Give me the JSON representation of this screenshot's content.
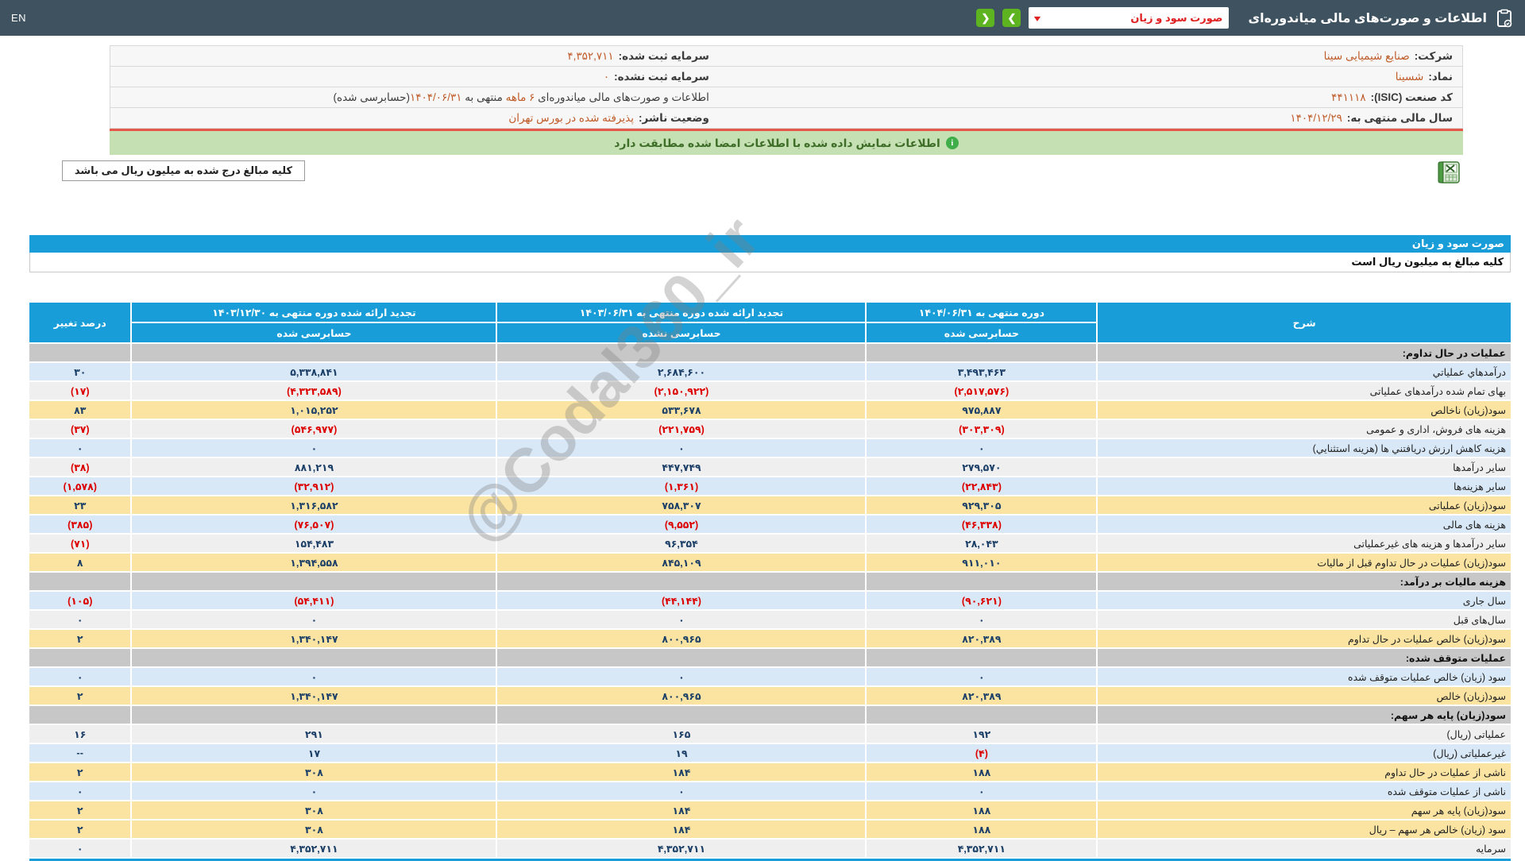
{
  "colors": {
    "accent_blue": "#189dd8",
    "topbar": "#3e5260",
    "negative": "#dd0000",
    "positive_number": "#1d4068",
    "highlight_row": "#fbe3a1",
    "banner_green": "#c5e0b3",
    "red_separator": "#e4574b",
    "nav_button_green": "#5eb321",
    "value_orange": "#bf5b28"
  },
  "topbar": {
    "title": "اطلاعات و صورت‌های مالی میاندوره‌ای",
    "report_select": {
      "value": "صورت سود و زیان",
      "chevron": "▾"
    },
    "nav_prev": "❮",
    "nav_next": "❯",
    "lang": "EN"
  },
  "company": {
    "rows": [
      {
        "rl": "شرکت:",
        "rv": "صنایع شیمیایی سینا",
        "ll": "سرمایه ثبت شده:",
        "lv": "۴,۳۵۲,۷۱۱"
      },
      {
        "rl": "نماد:",
        "rv": "شسینا",
        "ll": "سرمایه ثبت نشده:",
        "lv": "۰"
      },
      {
        "rl": "کد صنعت (ISIC):",
        "rv": "۴۴۱۱۱۸"
      },
      {
        "rl": "سال مالی منتهی به:",
        "rv": "۱۴۰۴/۱۲/۲۹",
        "ll": "وضعیت ناشر:",
        "lv": "پذیرفته شده در بورس تهران"
      }
    ],
    "info_sentence": {
      "p1": "اطلاعات و صورت‌های مالی میاندوره‌ای ",
      "p2": "۶ ماهه",
      "p3": " منتهی به ",
      "p4": "۱۴۰۴/۰۶/۳۱",
      "p5": "(حسابرسی شده)"
    }
  },
  "banner": {
    "text": "اطلاعات نمایش داده شده با اطلاعات امضا شده مطابقت دارد",
    "icon": "i"
  },
  "unit_note": "کلیه مبالغ درج شده به میلیون ریال می باشد",
  "statement": {
    "title": "صورت سود و زیان",
    "unit_note": "کلیه مبالغ به میلیون ریال است"
  },
  "watermark": {
    "text": "@Codal360_ir"
  },
  "table": {
    "col_desc": "شرح",
    "col_groups": [
      {
        "title": "دوره منتهی به ۱۴۰۴/۰۶/۳۱",
        "sub": "حسابرسی شده"
      },
      {
        "title": "تجدید ارائه شده دوره منتهی به ۱۴۰۳/۰۶/۳۱",
        "sub": "حسابرسی نشده"
      },
      {
        "title": "تجدید ارائه شده دوره منتهی به ۱۴۰۳/۱۲/۳۰",
        "sub": "حسابرسی شده"
      }
    ],
    "col_pct": "درصد تغییر",
    "rows": [
      {
        "type": "section",
        "label": "عملیات در حال تداوم:"
      },
      {
        "type": "data",
        "tone": "blue",
        "label": "درآمدهاي عملياتي",
        "v1": "۳,۴۹۳,۴۶۳",
        "v2": "۲,۶۸۴,۶۰۰",
        "v3": "۵,۳۳۸,۸۴۱",
        "pct": "۳۰"
      },
      {
        "type": "data",
        "tone": "gray",
        "label": "بهای تمام شده درآمدهای عملیاتی",
        "v1": "(۲,۵۱۷,۵۷۶)",
        "v2": "(۲,۱۵۰,۹۲۲)",
        "v3": "(۴,۳۲۳,۵۸۹)",
        "pct": "(۱۷)"
      },
      {
        "type": "data",
        "tone": "yellow",
        "label": "سود(زیان) ناخالص",
        "v1": "۹۷۵,۸۸۷",
        "v2": "۵۳۳,۶۷۸",
        "v3": "۱,۰۱۵,۲۵۲",
        "pct": "۸۳"
      },
      {
        "type": "data",
        "tone": "gray",
        "label": "هزینه های فروش، اداری و عمومی",
        "v1": "(۳۰۳,۳۰۹)",
        "v2": "(۲۲۱,۷۵۹)",
        "v3": "(۵۴۶,۹۷۷)",
        "pct": "(۳۷)"
      },
      {
        "type": "data",
        "tone": "blue",
        "label": "هزينه کاهش ارزش دريافتني ها (هزينه استثنايي)",
        "v1": "۰",
        "v2": "۰",
        "v3": "۰",
        "pct": "۰"
      },
      {
        "type": "data",
        "tone": "gray",
        "label": "سایر درآمدها",
        "v1": "۲۷۹,۵۷۰",
        "v2": "۴۴۷,۷۴۹",
        "v3": "۸۸۱,۲۱۹",
        "pct": "(۳۸)"
      },
      {
        "type": "data",
        "tone": "blue",
        "label": "سایر هزینه‌ها",
        "v1": "(۲۲,۸۴۳)",
        "v2": "(۱,۳۶۱)",
        "v3": "(۳۲,۹۱۲)",
        "pct": "(۱,۵۷۸)"
      },
      {
        "type": "data",
        "tone": "yellow",
        "label": "سود(زیان) عملیاتی",
        "v1": "۹۲۹,۳۰۵",
        "v2": "۷۵۸,۳۰۷",
        "v3": "۱,۳۱۶,۵۸۲",
        "pct": "۲۳"
      },
      {
        "type": "data",
        "tone": "blue",
        "label": "هزینه های مالی",
        "v1": "(۴۶,۳۳۸)",
        "v2": "(۹,۵۵۲)",
        "v3": "(۷۶,۵۰۷)",
        "pct": "(۳۸۵)"
      },
      {
        "type": "data",
        "tone": "gray",
        "label": "سایر درآمدها و هزینه های غیرعملیاتی",
        "v1": "۲۸,۰۴۳",
        "v2": "۹۶,۳۵۴",
        "v3": "۱۵۴,۴۸۳",
        "pct": "(۷۱)"
      },
      {
        "type": "data",
        "tone": "yellow",
        "label": "سود(زیان) عملیات در حال تداوم قبل از مالیات",
        "v1": "۹۱۱,۰۱۰",
        "v2": "۸۴۵,۱۰۹",
        "v3": "۱,۳۹۴,۵۵۸",
        "pct": "۸"
      },
      {
        "type": "section",
        "label": "هزینه مالیات بر درآمد:"
      },
      {
        "type": "data",
        "tone": "blue",
        "label": "سال جاری",
        "v1": "(۹۰,۶۲۱)",
        "v2": "(۴۴,۱۴۴)",
        "v3": "(۵۴,۴۱۱)",
        "pct": "(۱۰۵)"
      },
      {
        "type": "data",
        "tone": "gray",
        "label": "سال‌های قبل",
        "v1": "۰",
        "v2": "۰",
        "v3": "۰",
        "pct": "۰"
      },
      {
        "type": "data",
        "tone": "yellow",
        "label": "سود(زیان) خالص عملیات در حال تداوم",
        "v1": "۸۲۰,۳۸۹",
        "v2": "۸۰۰,۹۶۵",
        "v3": "۱,۳۴۰,۱۴۷",
        "pct": "۲"
      },
      {
        "type": "section",
        "label": "عملیات متوقف شده:"
      },
      {
        "type": "data",
        "tone": "blue",
        "label": "سود (زیان) خالص عملیات متوقف شده",
        "v1": "۰",
        "v2": "۰",
        "v3": "۰",
        "pct": "۰"
      },
      {
        "type": "data",
        "tone": "yellow",
        "label": "سود(زیان) خالص",
        "v1": "۸۲۰,۳۸۹",
        "v2": "۸۰۰,۹۶۵",
        "v3": "۱,۳۴۰,۱۴۷",
        "pct": "۲"
      },
      {
        "type": "section",
        "label": "سود(زیان) پایه هر سهم:"
      },
      {
        "type": "data",
        "tone": "gray",
        "label": "عملیاتی (ریال)",
        "v1": "۱۹۲",
        "v2": "۱۶۵",
        "v3": "۲۹۱",
        "pct": "۱۶"
      },
      {
        "type": "data",
        "tone": "blue",
        "label": "غیرعملیاتی (ریال)",
        "v1": "(۴)",
        "v2": "۱۹",
        "v3": "۱۷",
        "pct": "--"
      },
      {
        "type": "data",
        "tone": "yellow",
        "label": "ناشی از عملیات در حال تداوم",
        "v1": "۱۸۸",
        "v2": "۱۸۴",
        "v3": "۳۰۸",
        "pct": "۲"
      },
      {
        "type": "data",
        "tone": "blue",
        "label": "ناشی از عملیات متوقف شده",
        "v1": "۰",
        "v2": "۰",
        "v3": "۰",
        "pct": "۰"
      },
      {
        "type": "data",
        "tone": "yellow",
        "label": "سود(زیان) پایه هر سهم",
        "v1": "۱۸۸",
        "v2": "۱۸۴",
        "v3": "۳۰۸",
        "pct": "۲"
      },
      {
        "type": "data",
        "tone": "yellow",
        "label": "سود (زیان) خالص هر سهم – ریال",
        "v1": "۱۸۸",
        "v2": "۱۸۴",
        "v3": "۳۰۸",
        "pct": "۲"
      },
      {
        "type": "data",
        "tone": "gray",
        "label": "سرمایه",
        "v1": "۴,۳۵۲,۷۱۱",
        "v2": "۴,۳۵۲,۷۱۱",
        "v3": "۴,۳۵۲,۷۱۱",
        "pct": "۰"
      }
    ]
  }
}
